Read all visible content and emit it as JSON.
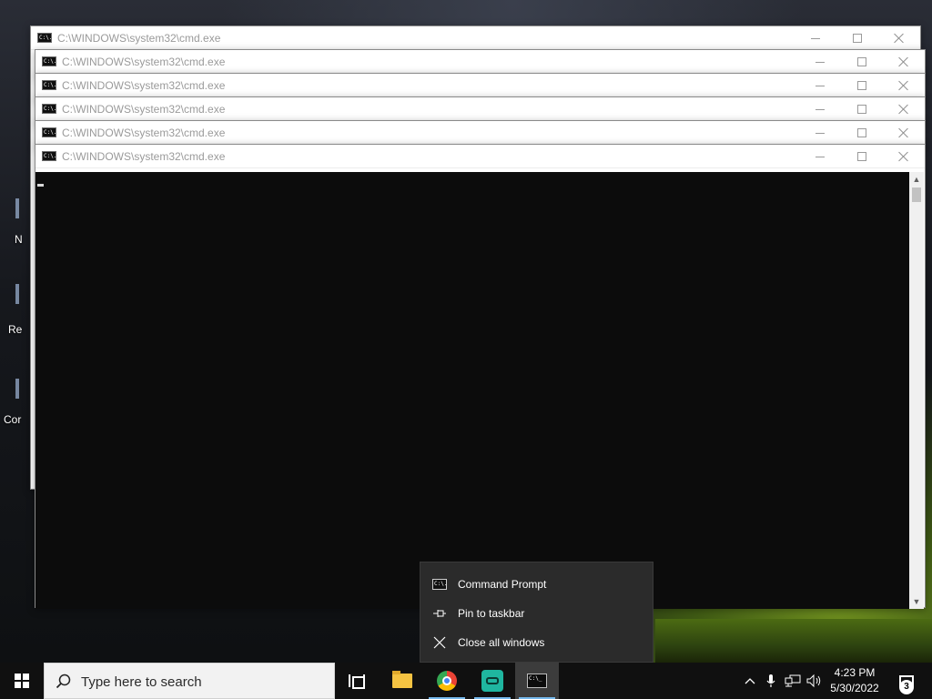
{
  "desktop": {
    "icon_labels": [
      "N",
      "Re",
      "Cor"
    ]
  },
  "windows": [
    {
      "title": "C:\\WINDOWS\\system32\\cmd.exe",
      "icon_text": "C:\\."
    },
    {
      "title": "C:\\WINDOWS\\system32\\cmd.exe",
      "icon_text": "C:\\."
    },
    {
      "title": "C:\\WINDOWS\\system32\\cmd.exe",
      "icon_text": "C:\\."
    },
    {
      "title": "C:\\WINDOWS\\system32\\cmd.exe",
      "icon_text": "C:\\."
    },
    {
      "title": "C:\\WINDOWS\\system32\\cmd.exe",
      "icon_text": "C:\\."
    },
    {
      "title": "C:\\WINDOWS\\system32\\cmd.exe",
      "icon_text": "C:\\."
    }
  ],
  "jumplist": {
    "items": [
      {
        "label": "Command Prompt",
        "icon": "cmd-icon"
      },
      {
        "label": "Pin to taskbar",
        "icon": "pin-icon"
      },
      {
        "label": "Close all windows",
        "icon": "close-icon"
      }
    ]
  },
  "taskbar": {
    "search_placeholder": "Type here to search",
    "apps": [
      "task-view-icon",
      "file-explorer-icon",
      "chrome-icon",
      "teal-app-icon",
      "command-prompt-icon"
    ],
    "clock_time": "4:23 PM",
    "clock_date": "5/30/2022",
    "notification_count": "3"
  },
  "colors": {
    "taskbar": "#101010",
    "console_bg": "#0c0c0c",
    "jumplist_bg": "#2b2b2b",
    "active_underline": "#76b9ed"
  }
}
